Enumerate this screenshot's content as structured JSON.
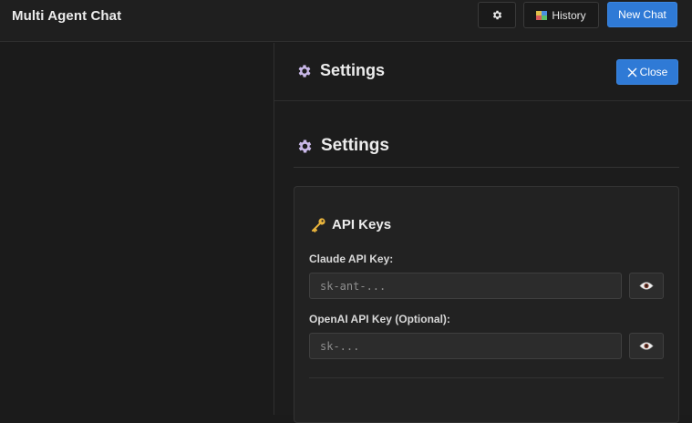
{
  "app": {
    "title": "Multi Agent Chat"
  },
  "toolbar": {
    "history_label": "History",
    "new_chat_label": "New Chat"
  },
  "settings_panel": {
    "header_title": "Settings",
    "close_label": "Close",
    "section_title": "Settings",
    "api_keys": {
      "title": "API Keys",
      "claude": {
        "label": "Claude API Key:",
        "value": "",
        "placeholder": "sk-ant-..."
      },
      "openai": {
        "label": "OpenAI API Key (Optional):",
        "value": "",
        "placeholder": "sk-..."
      }
    }
  },
  "colors": {
    "accent": "#2f7ad6",
    "background": "#1b1b1b",
    "gear": "#c9b8e8",
    "key": "#e9b43c"
  },
  "icons": [
    "gear-icon",
    "history-icon",
    "close-icon",
    "key-icon",
    "eye-icon"
  ]
}
